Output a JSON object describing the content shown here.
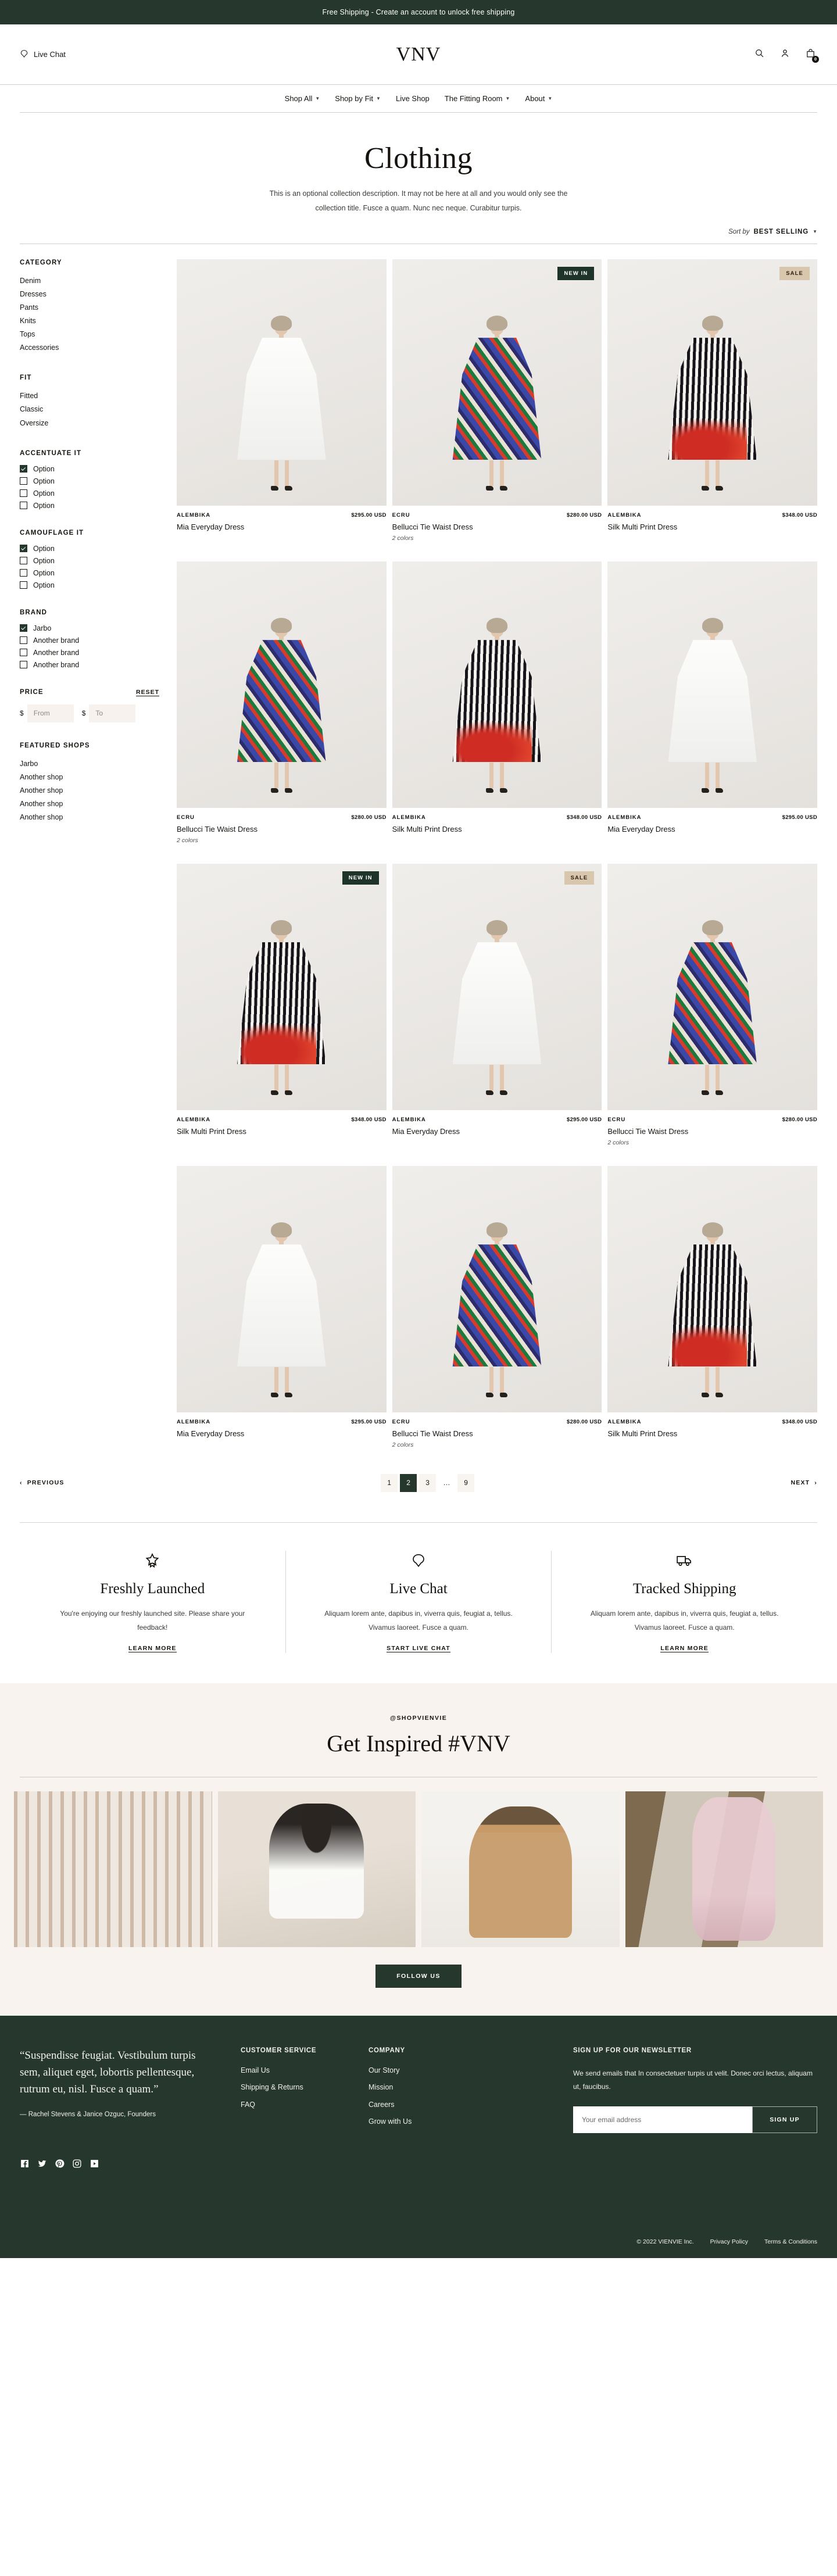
{
  "announcement": {
    "text": "Free Shipping - Create an account to unlock free shipping"
  },
  "header": {
    "live_chat": "Live Chat",
    "logo": "VNV",
    "cart_count": "0",
    "icons": {
      "search": "search-icon",
      "account": "account-icon",
      "cart": "shopping-bag-icon"
    }
  },
  "nav": {
    "items": [
      {
        "label": "Shop All",
        "has_caret": true
      },
      {
        "label": "Shop by Fit",
        "has_caret": true
      },
      {
        "label": "Live Shop",
        "has_caret": false
      },
      {
        "label": "The Fitting Room",
        "has_caret": true
      },
      {
        "label": "About",
        "has_caret": true
      }
    ]
  },
  "collection": {
    "title": "Clothing",
    "description": "This is an optional collection description. It may not be here at all and you would only see the collection title. Fusce a quam. Nunc nec neque. Curabitur turpis.",
    "sort_label": "Sort by",
    "sort_value": "BEST SELLING"
  },
  "filters": {
    "category": {
      "title": "CATEGORY",
      "items": [
        "Denim",
        "Dresses",
        "Pants",
        "Knits",
        "Tops",
        "Accessories"
      ]
    },
    "fit": {
      "title": "FIT",
      "items": [
        "Fitted",
        "Classic",
        "Oversize"
      ]
    },
    "accentuate": {
      "title": "ACCENTUATE IT",
      "options": [
        {
          "label": "Option",
          "checked": true
        },
        {
          "label": "Option",
          "checked": false
        },
        {
          "label": "Option",
          "checked": false
        },
        {
          "label": "Option",
          "checked": false
        }
      ]
    },
    "camouflage": {
      "title": "CAMOUFLAGE IT",
      "options": [
        {
          "label": "Option",
          "checked": true
        },
        {
          "label": "Option",
          "checked": false
        },
        {
          "label": "Option",
          "checked": false
        },
        {
          "label": "Option",
          "checked": false
        }
      ]
    },
    "brand": {
      "title": "BRAND",
      "options": [
        {
          "label": "Jarbo",
          "checked": true
        },
        {
          "label": "Another brand",
          "checked": false
        },
        {
          "label": "Another brand",
          "checked": false
        },
        {
          "label": "Another brand",
          "checked": false
        }
      ]
    },
    "price": {
      "title": "PRICE",
      "reset": "RESET",
      "currency": "$",
      "from_placeholder": "From",
      "to_placeholder": "To",
      "from_value": "",
      "to_value": ""
    },
    "featured_shops": {
      "title": "FEATURED SHOPS",
      "items": [
        "Jarbo",
        "Another shop",
        "Another shop",
        "Another shop",
        "Another shop"
      ]
    }
  },
  "products": [
    {
      "vendor": "ALEMBIKA",
      "price": "$295.00 USD",
      "title": "Mia Everyday Dress",
      "colors": "",
      "badge": "",
      "style": "d-white"
    },
    {
      "vendor": "ECRU",
      "price": "$280.00 USD",
      "title": "Bellucci Tie Waist Dress",
      "colors": "2 colors",
      "badge": "NEW IN",
      "style": "d-print"
    },
    {
      "vendor": "ALEMBIKA",
      "price": "$348.00 USD",
      "title": "Silk Multi Print Dress",
      "colors": "",
      "badge": "SALE",
      "style": "d-stripe"
    },
    {
      "vendor": "ECRU",
      "price": "$280.00 USD",
      "title": "Bellucci Tie Waist Dress",
      "colors": "2 colors",
      "badge": "",
      "style": "d-print"
    },
    {
      "vendor": "ALEMBIKA",
      "price": "$348.00 USD",
      "title": "Silk Multi Print Dress",
      "colors": "",
      "badge": "",
      "style": "d-stripe"
    },
    {
      "vendor": "ALEMBIKA",
      "price": "$295.00 USD",
      "title": "Mia Everyday Dress",
      "colors": "",
      "badge": "",
      "style": "d-white"
    },
    {
      "vendor": "ALEMBIKA",
      "price": "$348.00 USD",
      "title": "Silk Multi Print Dress",
      "colors": "",
      "badge": "NEW IN",
      "style": "d-stripe"
    },
    {
      "vendor": "ALEMBIKA",
      "price": "$295.00 USD",
      "title": "Mia Everyday Dress",
      "colors": "",
      "badge": "SALE",
      "style": "d-white"
    },
    {
      "vendor": "ECRU",
      "price": "$280.00 USD",
      "title": "Bellucci Tie Waist Dress",
      "colors": "2 colors",
      "badge": "",
      "style": "d-print"
    },
    {
      "vendor": "ALEMBIKA",
      "price": "$295.00 USD",
      "title": "Mia Everyday Dress",
      "colors": "",
      "badge": "",
      "style": "d-white"
    },
    {
      "vendor": "ECRU",
      "price": "$280.00 USD",
      "title": "Bellucci Tie Waist Dress",
      "colors": "2 colors",
      "badge": "",
      "style": "d-print"
    },
    {
      "vendor": "ALEMBIKA",
      "price": "$348.00 USD",
      "title": "Silk Multi Print Dress",
      "colors": "",
      "badge": "",
      "style": "d-stripe"
    }
  ],
  "pagination": {
    "previous": "PREVIOUS",
    "next": "NEXT",
    "pages": [
      "1",
      "2",
      "3",
      "…",
      "9"
    ],
    "current": "2"
  },
  "features": [
    {
      "icon": "star-bookmark-icon",
      "title": "Freshly Launched",
      "body": "You're enjoying our freshly launched site. Please share your feedback!",
      "cta": "LEARN MORE"
    },
    {
      "icon": "chat-bubble-icon",
      "title": "Live Chat",
      "body": "Aliquam lorem ante, dapibus in, viverra quis, feugiat a, tellus. Vivamus laoreet. Fusce a quam.",
      "cta": "START LIVE CHAT"
    },
    {
      "icon": "delivery-truck-icon",
      "title": "Tracked Shipping",
      "body": "Aliquam lorem ante, dapibus in, viverra quis, feugiat a, tellus. Vivamus laoreet. Fusce a quam.",
      "cta": "LEARN MORE"
    }
  ],
  "inspired": {
    "handle": "@SHOPVIENVIE",
    "title": "Get Inspired #VNV",
    "follow_button": "FOLLOW US",
    "gallery": [
      {
        "alt": "clothing-rack"
      },
      {
        "alt": "woman-on-couch"
      },
      {
        "alt": "woman-with-hat"
      },
      {
        "alt": "woman-in-pink-dress"
      }
    ]
  },
  "footer": {
    "quote": "“Suspendisse feugiat. Vestibulum turpis sem, aliquet eget, lobortis pellentesque, rutrum eu, nisl. Fusce a quam.”",
    "attribution": "— Rachel Stevens & Janice Ozguc, Founders",
    "customer_service": {
      "title": "CUSTOMER SERVICE",
      "links": [
        "Email Us",
        "Shipping & Returns",
        "FAQ"
      ]
    },
    "company": {
      "title": "COMPANY",
      "links": [
        "Our Story",
        "Mission",
        "Careers",
        "Grow with Us"
      ]
    },
    "newsletter": {
      "title": "SIGN UP FOR OUR NEWSLETTER",
      "text": "We send emails that In consectetuer turpis ut velit. Donec orci lectus, aliquam ut, faucibus.",
      "placeholder": "Your email address",
      "value": "",
      "button": "SIGN UP"
    },
    "socials": [
      "facebook-icon",
      "twitter-icon",
      "pinterest-icon",
      "instagram-icon",
      "youtube-icon"
    ],
    "copyright": "© 2022 VIENVIE Inc.",
    "privacy": "Privacy Policy",
    "terms": "Terms & Conditions"
  },
  "colors": {
    "brand_green": "#26382d",
    "badge_new": "#1e3329",
    "badge_sale": "#d8c7ad",
    "cream": "#f8f3ef",
    "ink": "#16130f"
  }
}
